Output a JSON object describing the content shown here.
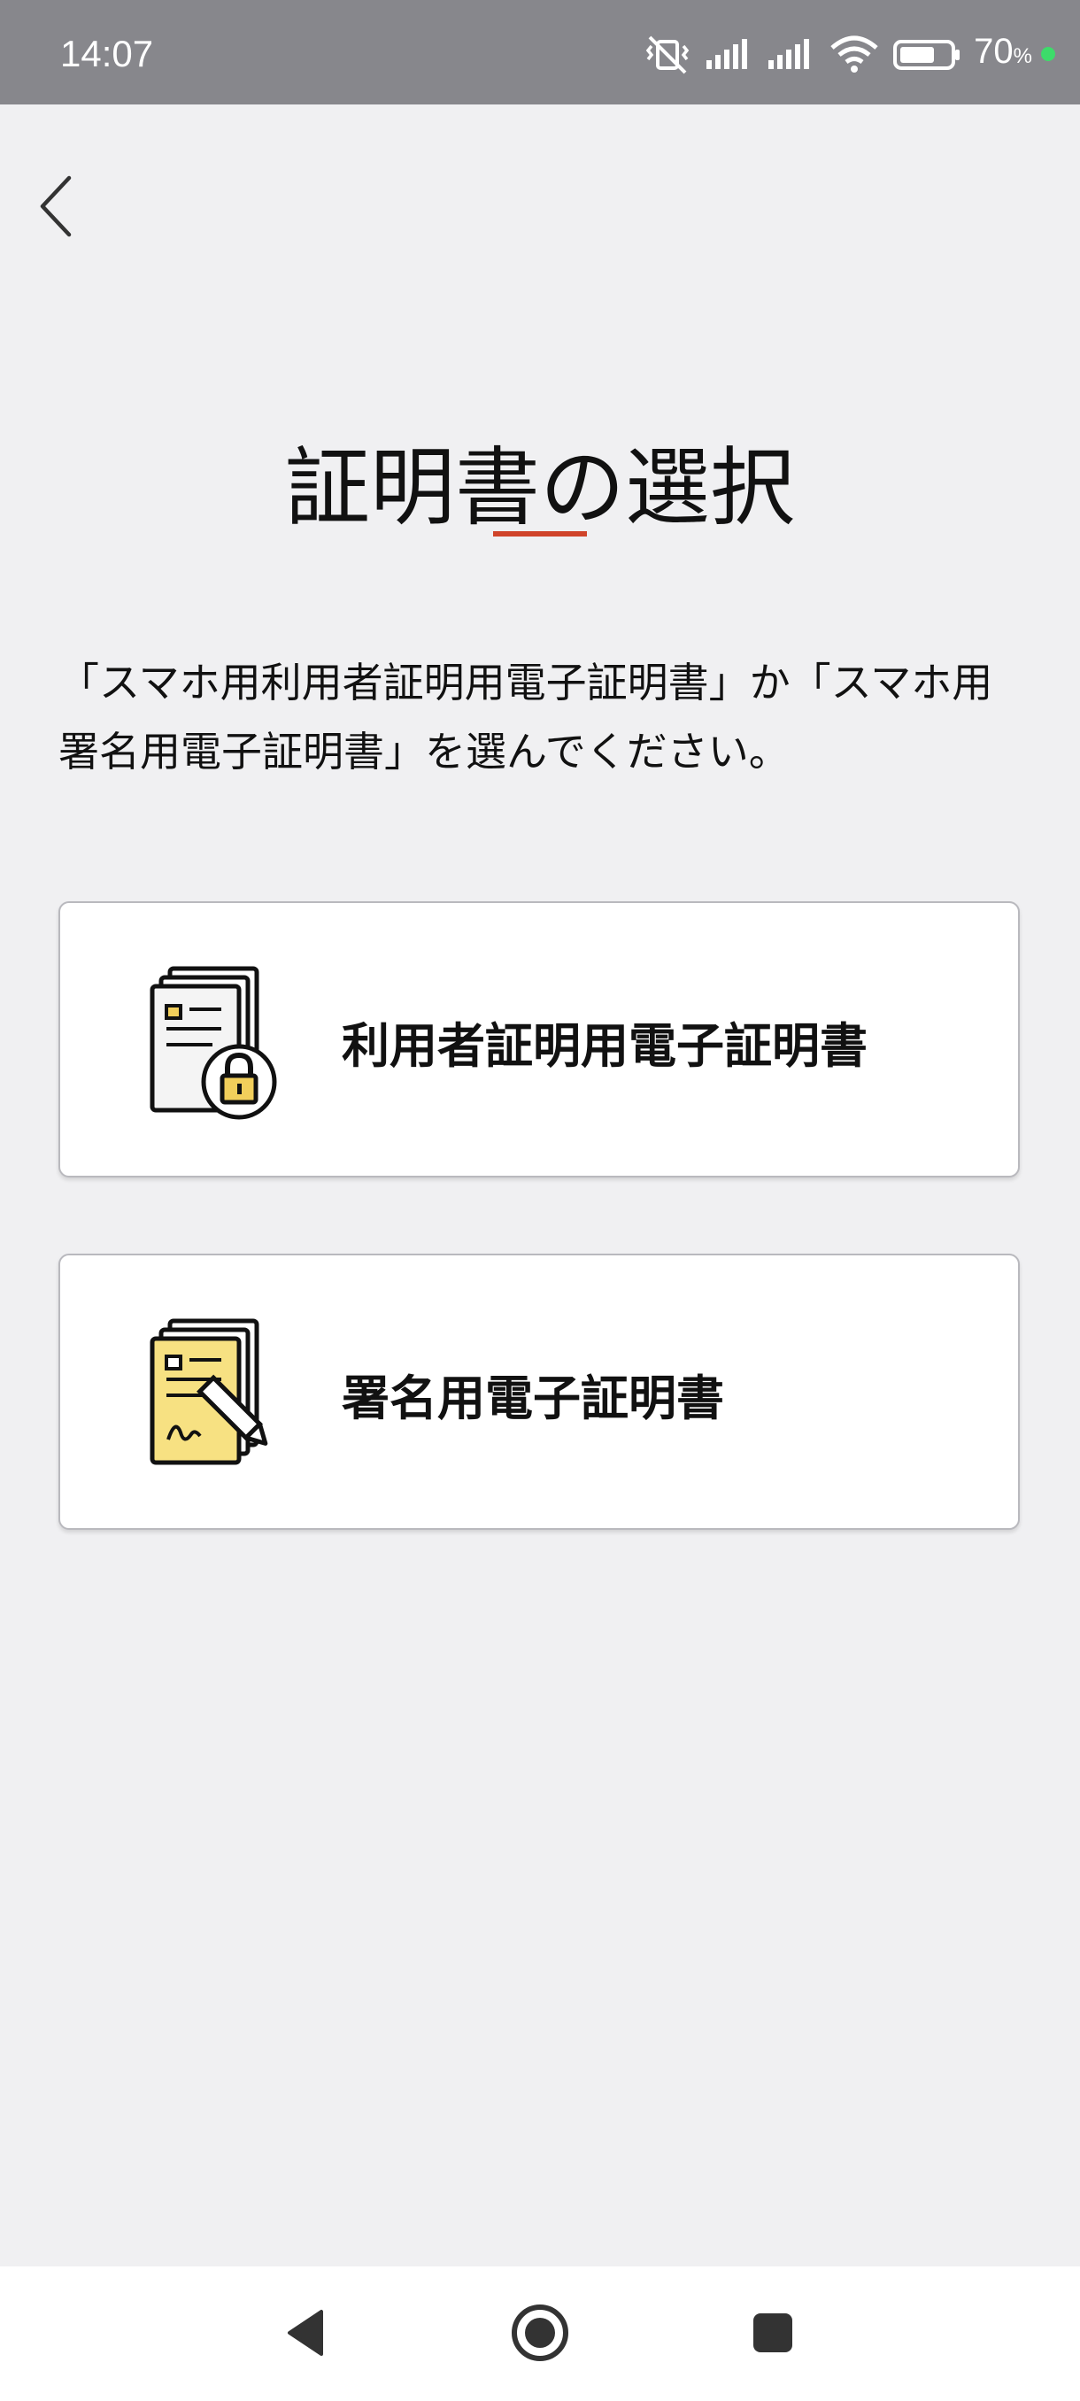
{
  "status_bar": {
    "time": "14:07",
    "battery_percent": "70",
    "battery_percent_sign": "%",
    "battery_level": 0.7,
    "charge_indicator_color": "#3ddc6a",
    "icons": [
      "vibrate-off-icon",
      "signal-icon",
      "signal-icon",
      "wifi-icon",
      "battery-icon"
    ]
  },
  "header": {
    "back_icon": "chevron-left-icon"
  },
  "main": {
    "title": "証明書の選択",
    "accent_color": "#d0442a",
    "instruction": "「スマホ用利用者証明用電子証明書」か「スマホ用署名用電子証明書」を選んでください。",
    "options": [
      {
        "label": "利用者証明用電子証明書",
        "icon": "document-lock-icon"
      },
      {
        "label": "署名用電子証明書",
        "icon": "document-signature-icon"
      }
    ]
  },
  "nav_bar": {
    "buttons": [
      "back-triangle-icon",
      "home-circle-icon",
      "recents-square-icon"
    ]
  }
}
